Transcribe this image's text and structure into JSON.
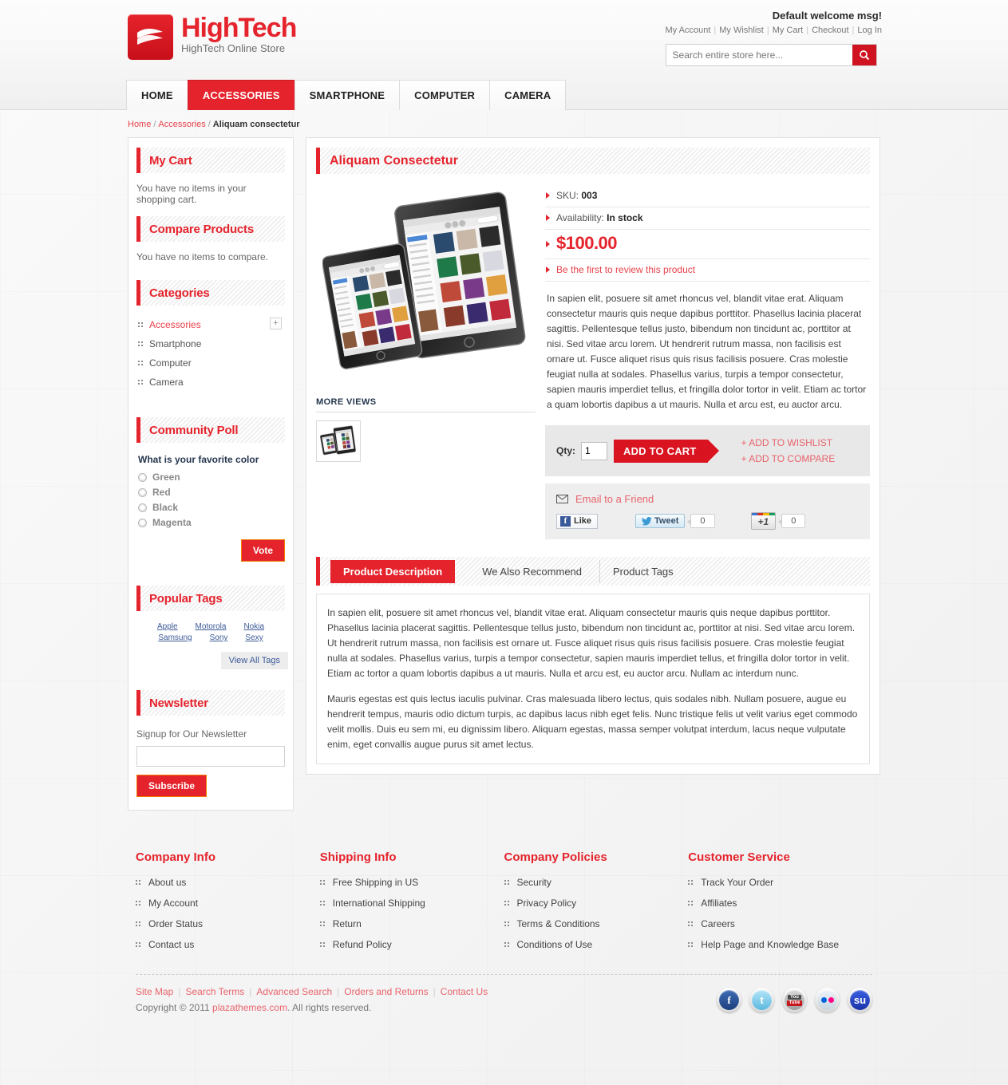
{
  "header": {
    "logo_title": "HighTech",
    "logo_subtitle": "HighTech Online Store",
    "welcome": "Default welcome msg!",
    "top_links": [
      {
        "label": "My Account"
      },
      {
        "label": "My Wishlist"
      },
      {
        "label": "My Cart"
      },
      {
        "label": "Checkout"
      },
      {
        "label": "Log In"
      }
    ],
    "search_placeholder": "Search entire store here...",
    "search_value": "",
    "search_icon": "search-icon"
  },
  "nav": [
    {
      "label": "HOME",
      "active": false
    },
    {
      "label": "ACCESSORIES",
      "active": true
    },
    {
      "label": "SMARTPHONE",
      "active": false
    },
    {
      "label": "COMPUTER",
      "active": false
    },
    {
      "label": "CAMERA",
      "active": false
    }
  ],
  "breadcrumb": {
    "home": "Home",
    "category": "Accessories",
    "current": "Aliquam consectetur",
    "separator": "/"
  },
  "sidebar": {
    "cart": {
      "title": "My Cart",
      "empty_text": "You have no items in your shopping cart."
    },
    "compare": {
      "title": "Compare Products",
      "empty_text": "You have no items to compare."
    },
    "categories": {
      "title": "Categories",
      "items": [
        {
          "label": "Accessories",
          "active": true,
          "expandable": true,
          "expand_label": "+"
        },
        {
          "label": "Smartphone",
          "active": false,
          "expandable": false
        },
        {
          "label": "Computer",
          "active": false,
          "expandable": false
        },
        {
          "label": "Camera",
          "active": false,
          "expandable": false
        }
      ]
    },
    "poll": {
      "title": "Community Poll",
      "question": "What is your favorite color",
      "options": [
        "Green",
        "Red",
        "Black",
        "Magenta"
      ],
      "vote_label": "Vote"
    },
    "tags": {
      "title": "Popular Tags",
      "row1": [
        "Apple",
        "Motorola",
        "Nokia"
      ],
      "row2": [
        "Samsung",
        "Sony",
        "Sexy"
      ],
      "view_all_label": "View All Tags"
    },
    "newsletter": {
      "title": "Newsletter",
      "label": "Signup for Our Newsletter",
      "input_value": "",
      "subscribe_label": "Subscribe"
    }
  },
  "product": {
    "title": "Aliquam Consectetur",
    "sku_label": "SKU:",
    "sku_value": "003",
    "availability_label": "Availability:",
    "availability_value": "In stock",
    "price": "$100.00",
    "review_link": "Be the first to review this product",
    "short_description": "In sapien elit, posuere sit amet rhoncus vel, blandit vitae erat. Aliquam consectetur mauris quis neque dapibus porttitor. Phasellus lacinia placerat sagittis. Pellentesque tellus justo, bibendum non tincidunt ac, porttitor at nisi. Sed vitae arcu lorem. Ut hendrerit rutrum massa, non facilisis est ornare ut. Fusce aliquet risus quis risus facilisis posuere. Cras molestie feugiat nulla at sodales. Phasellus varius, turpis a tempor consectetur, sapien mauris imperdiet tellus, et fringilla dolor tortor in velit. Etiam ac tortor a quam lobortis dapibus a ut mauris. Nulla et arcu est, eu auctor arcu.",
    "more_views_label": "MORE VIEWS",
    "qty_label": "Qty:",
    "qty_value": "1",
    "add_to_cart_label": "ADD TO CART",
    "add_to_wishlist_label": "+ ADD TO WISHLIST",
    "add_to_compare_label": "+ ADD TO COMPARE",
    "email_friend_label": "Email to a Friend",
    "facebook_like_label": "Like",
    "tweet_label": "Tweet",
    "tweet_count": "0",
    "gplus_label": "+1",
    "gplus_count": "0"
  },
  "tabs": [
    {
      "label": "Product Description",
      "active": true
    },
    {
      "label": "We Also Recommend",
      "active": false
    },
    {
      "label": "Product Tags",
      "active": false
    }
  ],
  "tab_content": {
    "paragraph1": "In sapien elit, posuere sit amet rhoncus vel, blandit vitae erat. Aliquam consectetur mauris quis neque dapibus porttitor. Phasellus lacinia placerat sagittis. Pellentesque tellus justo, bibendum non tincidunt ac, porttitor at nisi. Sed vitae arcu lorem. Ut hendrerit rutrum massa, non facilisis est ornare ut. Fusce aliquet risus quis risus facilisis posuere. Cras molestie feugiat nulla at sodales. Phasellus varius, turpis a tempor consectetur, sapien mauris imperdiet tellus, et fringilla dolor tortor in velit. Etiam ac tortor a quam lobortis dapibus a ut mauris. Nulla et arcu est, eu auctor arcu. Nullam ac interdum nunc.",
    "paragraph2": "Mauris egestas est quis lectus iaculis pulvinar. Cras malesuada libero lectus, quis sodales nibh. Nullam posuere, augue eu hendrerit tempus, mauris odio dictum turpis, ac dapibus lacus nibh eget felis. Nunc tristique felis ut velit varius eget commodo velit mollis. Duis eu sem mi, eu dignissim libero. Aliquam egestas, massa semper volutpat interdum, lacus neque vulputate enim, eget convallis augue purus sit amet lectus."
  },
  "footer": {
    "columns": [
      {
        "title": "Company Info",
        "items": [
          "About us",
          "My Account",
          "Order Status",
          "Contact us"
        ]
      },
      {
        "title": "Shipping Info",
        "items": [
          "Free Shipping in US",
          "International Shipping",
          "Return",
          "Refund Policy"
        ]
      },
      {
        "title": "Company Policies",
        "items": [
          "Security",
          "Privacy Policy",
          "Terms & Conditions",
          "Conditions of Use"
        ]
      },
      {
        "title": "Customer Service",
        "items": [
          "Track Your Order",
          "Affiliates",
          "Careers",
          "Help Page and Knowledge Base"
        ]
      }
    ],
    "links": [
      "Site Map",
      "Search Terms",
      "Advanced Search",
      "Orders and Returns",
      "Contact Us"
    ],
    "copyright_prefix": "Copyright © 2011 ",
    "copyright_link": "plazathemes.com",
    "copyright_suffix": ". All rights reserved.",
    "social": [
      {
        "name": "facebook-icon",
        "glyph": "f"
      },
      {
        "name": "twitter-icon",
        "glyph": "t"
      },
      {
        "name": "youtube-icon",
        "glyph": ""
      },
      {
        "name": "flickr-icon",
        "glyph": ""
      },
      {
        "name": "stumbleupon-icon",
        "glyph": ""
      }
    ]
  },
  "colors": {
    "brand_red": "#e5232c",
    "link_red": "#e8424b",
    "dark_red": "#cf1320"
  }
}
